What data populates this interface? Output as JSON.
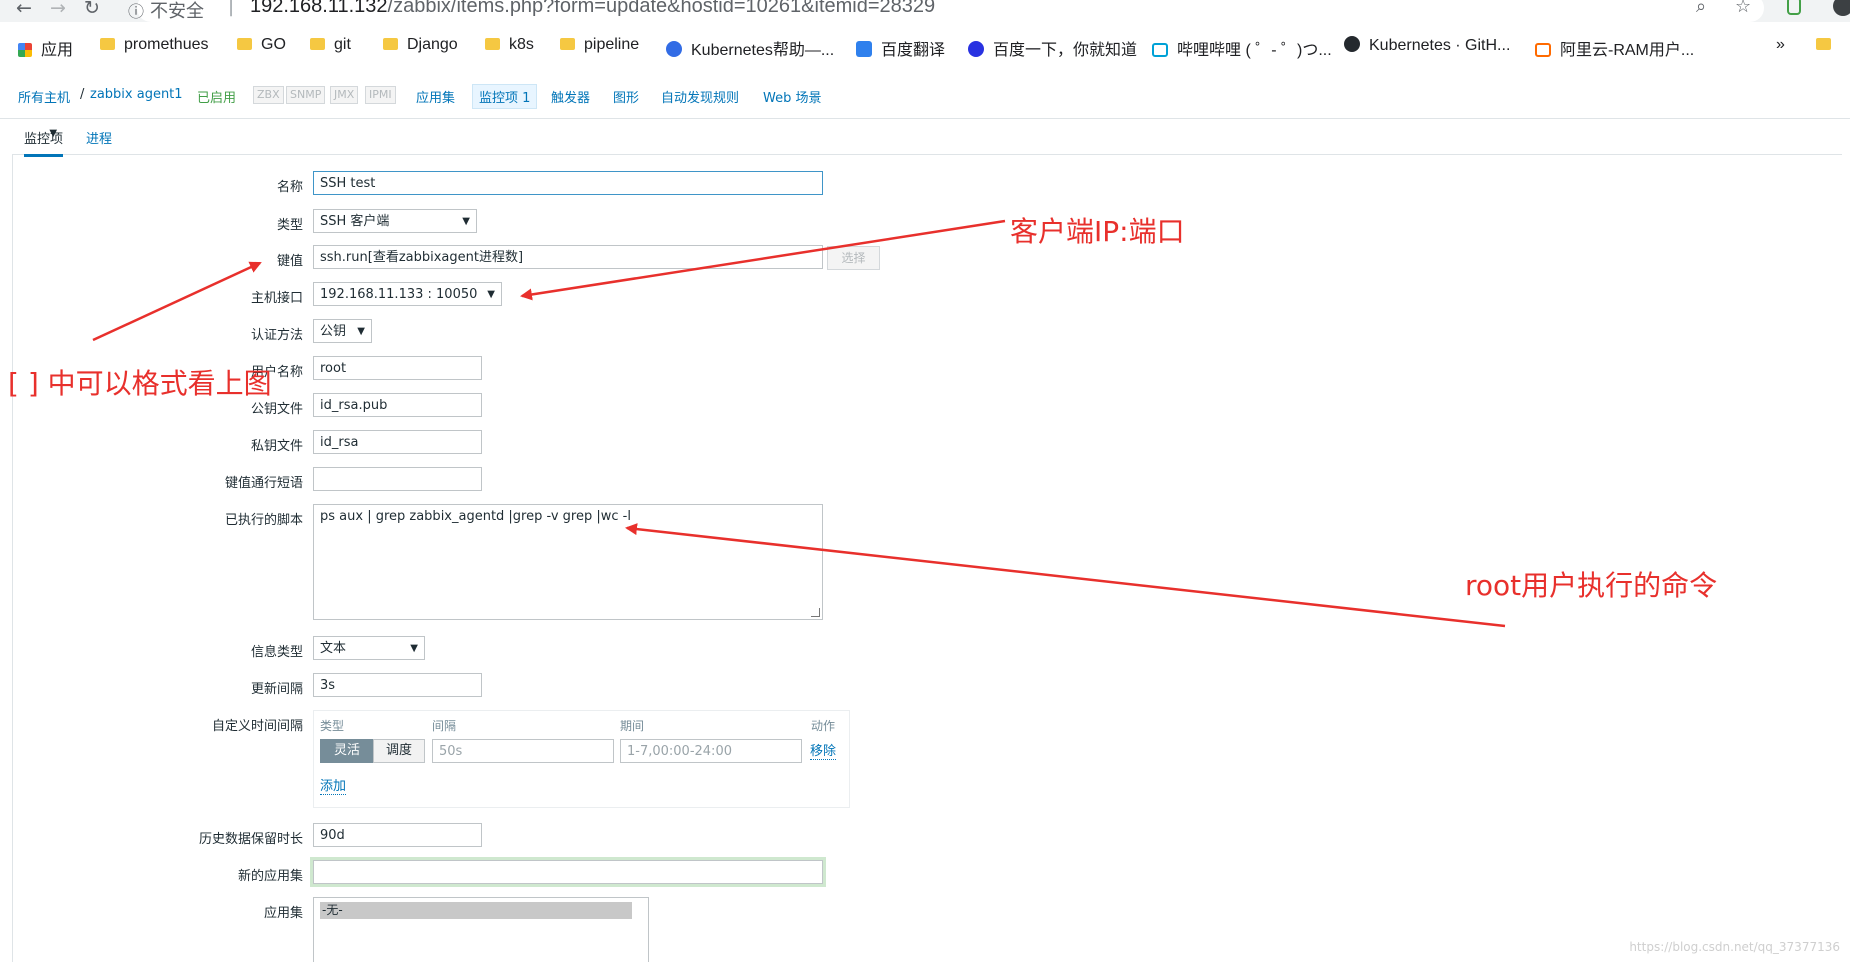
{
  "browser": {
    "security_label": "不安全",
    "url_host": "192.168.11.132",
    "url_rest": "/zabbix/items.php?form=update&hostid=10261&itemid=28329"
  },
  "bookmarks": [
    {
      "label": "应用",
      "icon": "apps-grid-icon"
    },
    {
      "label": "promethues",
      "icon": "folder-icon"
    },
    {
      "label": "GO",
      "icon": "folder-icon"
    },
    {
      "label": "git",
      "icon": "folder-icon"
    },
    {
      "label": "Django",
      "icon": "folder-icon"
    },
    {
      "label": "k8s",
      "icon": "folder-icon"
    },
    {
      "label": "pipeline",
      "icon": "folder-icon"
    },
    {
      "label": "Kubernetes帮助—...",
      "icon": "kubernetes-icon"
    },
    {
      "label": "百度翻译",
      "icon": "baidu-translate-icon"
    },
    {
      "label": "百度一下，你就知道",
      "icon": "baidu-paw-icon"
    },
    {
      "label": "哔哩哔哩 ( ゜- ゜)つ...",
      "icon": "bilibili-icon"
    },
    {
      "label": "Kubernetes · GitH...",
      "icon": "github-icon"
    },
    {
      "label": "阿里云-RAM用户...",
      "icon": "aliyun-icon"
    },
    {
      "label": "»",
      "icon": "more-icon"
    }
  ],
  "zabbix_nav": {
    "all_hosts": "所有主机",
    "separator": "/",
    "host": "zabbix agent1",
    "status": "已启用",
    "tags": [
      "ZBX",
      "SNMP",
      "JMX",
      "IPMI"
    ],
    "links": [
      "应用集",
      "监控项 1",
      "触发器",
      "图形",
      "自动发现规则",
      "Web 场景"
    ]
  },
  "tabs": [
    "监控项",
    "进程"
  ],
  "form": {
    "name_label": "名称",
    "name_value": "SSH  test",
    "type_label": "类型",
    "type_value": "SSH 客户端",
    "key_label": "键值",
    "key_value": "ssh.run[查看zabbixagent进程数]",
    "select_button": "选择",
    "interface_label": "主机接口",
    "interface_value": "192.168.11.133 : 10050",
    "auth_label": "认证方法",
    "auth_value": "公钥",
    "user_label": "用户名称",
    "user_value": "root",
    "pubkey_label": "公钥文件",
    "pubkey_value": "id_rsa.pub",
    "privkey_label": "私钥文件",
    "privkey_value": "id_rsa",
    "passphrase_label": "键值通行短语",
    "passphrase_value": "",
    "script_label": "已执行的脚本",
    "script_value": "ps aux | grep zabbix_agentd |grep -v grep  |wc -l",
    "info_type_label": "信息类型",
    "info_type_value": "文本",
    "interval_label": "更新间隔",
    "interval_value": "3s",
    "custom_interval_label": "自定义时间间隔",
    "custom_interval": {
      "col_type": "类型",
      "col_interval": "间隔",
      "col_period": "期间",
      "col_action": "动作",
      "flexible": "灵活",
      "scheduling": "调度",
      "interval_placeholder": "50s",
      "period_placeholder": "1-7,00:00-24:00",
      "remove": "移除",
      "add": "添加"
    },
    "history_label": "历史数据保留时长",
    "history_value": "90d",
    "new_app_label": "新的应用集",
    "new_app_value": "",
    "apps_label": "应用集",
    "apps_option": "-无-"
  },
  "annotations": {
    "client_ip_port": "客户端IP:端口",
    "bracket_format": "[ ] 中可以格式看上图",
    "root_command": "root用户执行的命令"
  },
  "watermark": "https://blog.csdn.net/qq_37377136",
  "colors": {
    "annotation_red": "#e8302c",
    "link_blue": "#0275b8",
    "enabled_green": "#429e47"
  }
}
